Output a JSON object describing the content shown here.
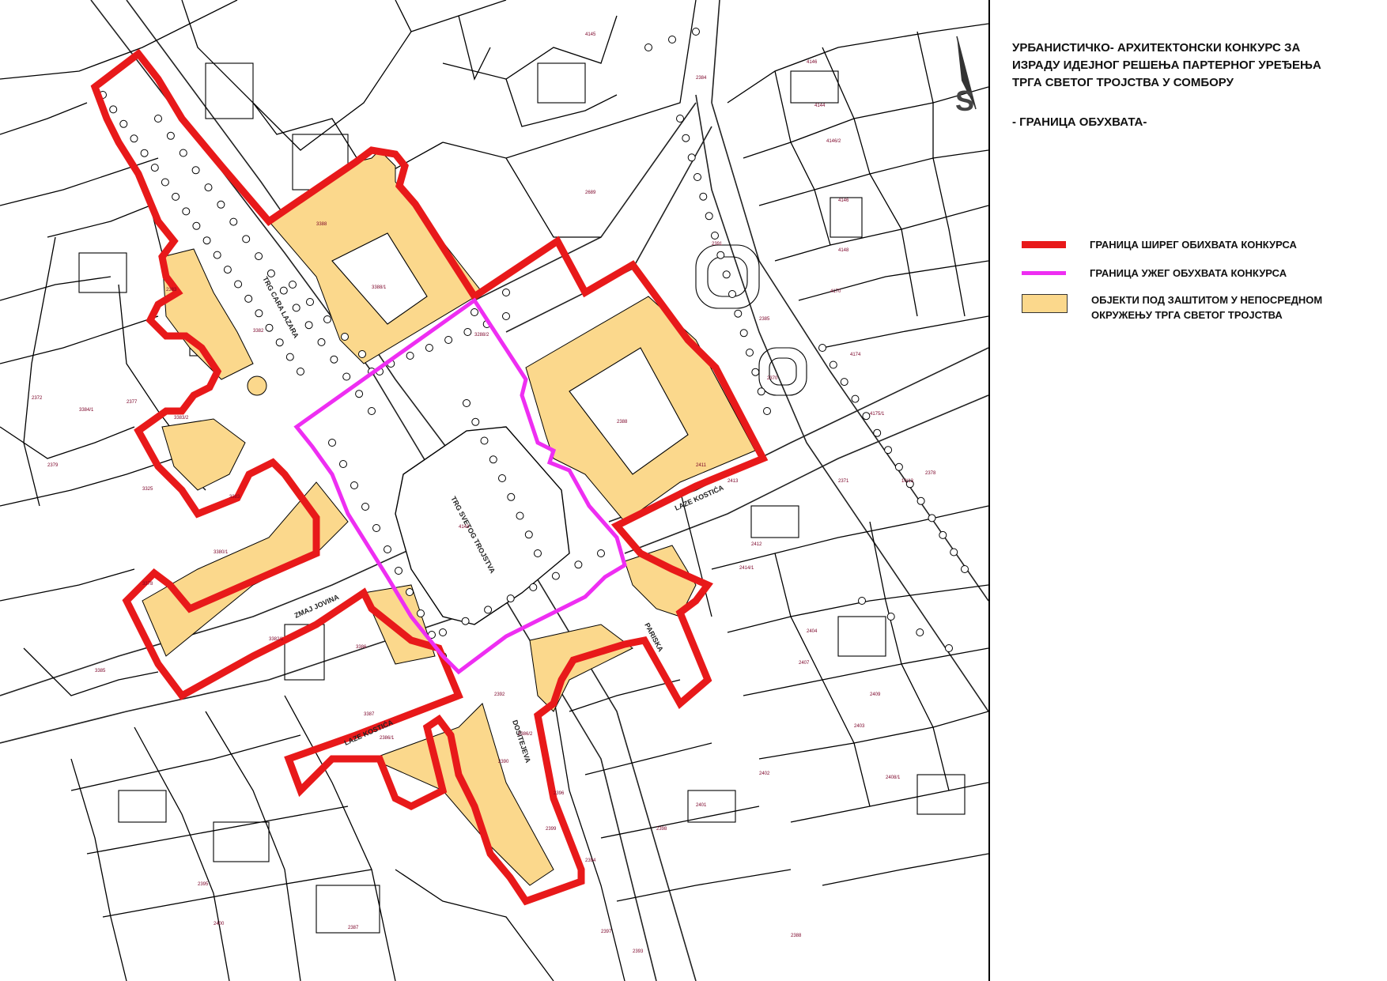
{
  "title_lines": [
    "УРБАНИСТИЧКО- АРХИТЕКТОНСКИ КОНКУРС ЗА",
    "ИЗРАДУ ИДЕЈНОГ РЕШЕЊА ПАРТЕРНОГ УРЕЂЕЊА",
    "ТРГА СВЕТОГ ТРОЈСТВА У СОМБОРУ"
  ],
  "subtitle": "- ГРАНИЦА ОБУХВАТА-",
  "north_arrow_label": "S",
  "legend": [
    {
      "label_lines": [
        "ГРАНИЦА ШИРЕГ ОБИХВАТА КОНКУРСА"
      ],
      "color": "#e8191a",
      "kind": "line"
    },
    {
      "label_lines": [
        "ГРАНИЦА УЖЕГ ОБУХВАТА КОНКУРСА"
      ],
      "color": "#ee2ef2",
      "kind": "line"
    },
    {
      "label_lines": [
        "ОБЈЕКТИ ПОД ЗАШТИТОМ У НЕПОСРЕДНОМ",
        "ОКРУЖЕЊУ ТРГА СВЕТОГ ТРОЈСТВА"
      ],
      "color": "#fbd88c",
      "kind": "fill"
    }
  ],
  "street_names": {
    "trg_cara_lazara": "TRG CARA LAZARA",
    "trg_svetog_trojstva": "TRG SVETOG TROJSTVA",
    "zmaj_jovina": "ZMAJ JOVINA",
    "laze_kostica_north": "LAZE KOSTIĆA",
    "laze_kostica_south": "LAZE KOSTIĆA",
    "parska": "PARISKA",
    "dositejeva": "DOSITEJEVA"
  },
  "parcel_labels": [
    "3388",
    "2689",
    "3388/1",
    "3288/2",
    "2388",
    "4143",
    "4145",
    "4146",
    "4144",
    "4146/2",
    "4146",
    "4148",
    "4170",
    "4174",
    "4175/1",
    "10/13",
    "2378",
    "2371",
    "2384",
    "2391",
    "2385",
    "2370",
    "2383",
    "2377",
    "2379",
    "2372",
    "3325",
    "3380/1",
    "3382",
    "3378",
    "3383",
    "3383/2",
    "3384/1",
    "3385",
    "3382/1",
    "3386",
    "3387",
    "2386/1",
    "2386/2",
    "2392",
    "2390",
    "2396",
    "2399",
    "2394",
    "2397",
    "2393",
    "2398",
    "2401",
    "2402",
    "2404",
    "2407",
    "2403",
    "2408/1",
    "2409",
    "2412",
    "2411",
    "2413",
    "2414/1",
    "2395",
    "2400",
    "2387",
    "2388"
  ],
  "colors": {
    "outer_boundary": "#e8191a",
    "inner_boundary": "#ee2ef2",
    "protected_fill": "#fbd88c"
  },
  "icons": [
    "north-arrow-icon",
    "tree-icon"
  ]
}
